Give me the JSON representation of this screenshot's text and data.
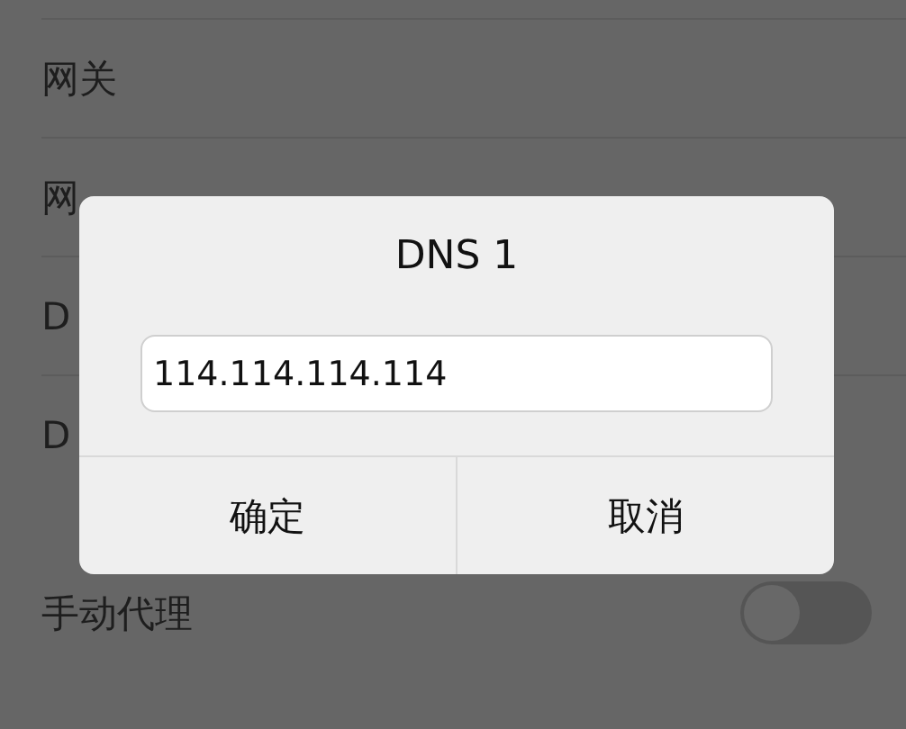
{
  "settings": {
    "items": [
      {
        "kind": "text",
        "label": "网关"
      },
      {
        "kind": "text",
        "label": "网"
      },
      {
        "kind": "text",
        "label": "D"
      },
      {
        "kind": "text",
        "label": "D"
      },
      {
        "kind": "toggle",
        "label": "手动代理",
        "on": false
      }
    ]
  },
  "dialog": {
    "title": "DNS 1",
    "input": {
      "value": "114.114.114.114"
    },
    "buttons": [
      "确定",
      "取消"
    ]
  }
}
